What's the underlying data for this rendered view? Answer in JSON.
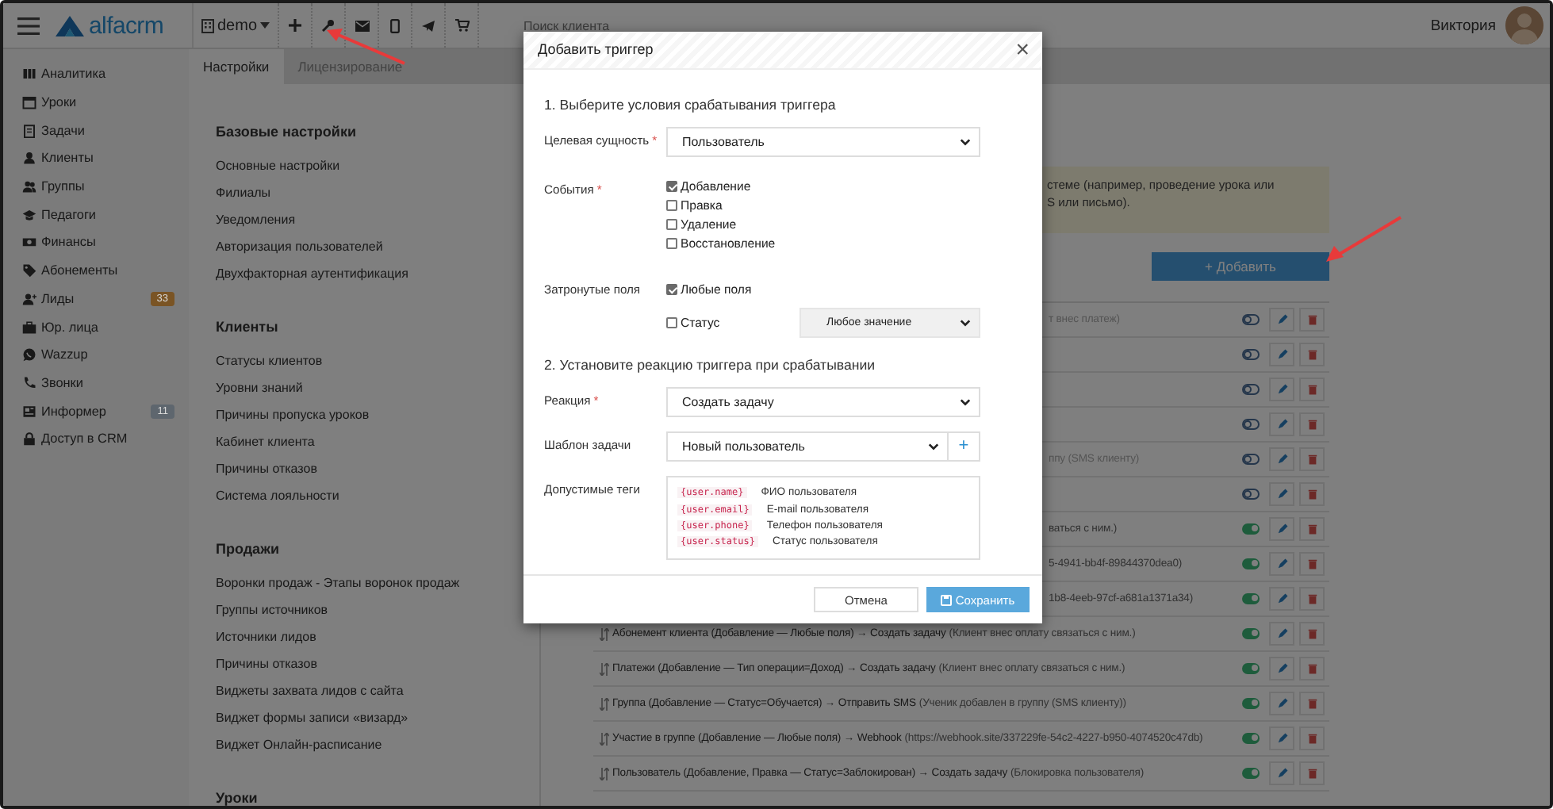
{
  "topbar": {
    "logo": "alfacrm",
    "branch": "demo",
    "search": {
      "placeholder": "Поиск клиента"
    },
    "user": "Виктория"
  },
  "sidebar": {
    "items": [
      {
        "label": "Аналитика"
      },
      {
        "label": "Уроки"
      },
      {
        "label": "Задачи"
      },
      {
        "label": "Клиенты"
      },
      {
        "label": "Группы"
      },
      {
        "label": "Педагоги"
      },
      {
        "label": "Финансы"
      },
      {
        "label": "Абонементы"
      },
      {
        "label": "Лиды",
        "badge": {
          "text": "33",
          "color": "#7a5424"
        }
      },
      {
        "label": "Юр. лица"
      },
      {
        "label": "Wazzup"
      },
      {
        "label": "Звонки"
      },
      {
        "label": "Информер",
        "badge": {
          "text": "11",
          "color": "#5e666e"
        }
      },
      {
        "label": "Доступ в CRM"
      }
    ]
  },
  "tabs": [
    {
      "label": "Настройки",
      "selected": true
    },
    {
      "label": "Лицензирование",
      "selected": false
    }
  ],
  "settings": [
    {
      "title": "Базовые настройки",
      "items": [
        "Основные настройки",
        "Филиалы",
        "Уведомления",
        "Авторизация пользователей",
        "Двухфакторная аутентификация"
      ]
    },
    {
      "title": "Клиенты",
      "items": [
        "Статусы клиентов",
        "Уровни знаний",
        "Причины пропуска уроков",
        "Кабинет клиента",
        "Причины отказов",
        "Система лояльности"
      ]
    },
    {
      "title": "Продажи",
      "items": [
        "Воронки продаж - Этапы воронок продаж",
        "Группы источников",
        "Источники лидов",
        "Причины отказов",
        "Виджеты захвата лидов с сайта",
        "Виджет формы записи «визард»",
        "Виджет Онлайн-расписание"
      ]
    },
    {
      "title": "Уроки"
    }
  ],
  "info": {
    "lines": [
      "стеме (например, проведение урока или",
      "S или письмо)."
    ]
  },
  "add_button": "+ Добавить",
  "triggers": [
    {
      "kind": "covered",
      "text": "т внес платеж)",
      "on": false
    },
    {
      "kind": "covered",
      "on": false
    },
    {
      "kind": "covered",
      "on": false
    },
    {
      "kind": "covered",
      "on": false
    },
    {
      "kind": "covered",
      "text": "ппу (SMS клиенту)",
      "on": false
    },
    {
      "kind": "covered",
      "on": false
    },
    {
      "kind": "covered",
      "text": "ваться с ним.)",
      "on": true
    },
    {
      "kind": "covered",
      "text": "5-4941-bb4f-89844370dea0)",
      "on": true
    },
    {
      "kind": "covered",
      "text": "1b8-4eeb-97cf-a681a1371a34)",
      "on": true
    },
    {
      "kind": "full",
      "rule": "Абонемент клиента (Добавление — Любые поля) → Создать задачу",
      "note": "(Клиент внес оплату связаться с ним.)",
      "on": true
    },
    {
      "kind": "full",
      "rule": "Платежи (Добавление — Тип операции=Доход) → Создать задачу",
      "note": "(Клиент внес оплату связаться с ним.)",
      "on": true
    },
    {
      "kind": "full",
      "rule": "Группа (Добавление — Статус=Обучается) → Отправить SMS",
      "note": "(Ученик добавлен в группу (SMS клиенту))",
      "on": true
    },
    {
      "kind": "full",
      "rule": "Участие в группе (Добавление — Любые поля) → Webhook",
      "note": "(https://webhook.site/337229fe-54c2-4227-b950-4074520c47db)",
      "on": true
    },
    {
      "kind": "full",
      "rule": "Пользователь (Добавление, Правка — Статус=Заблокирован) → Создать задачу",
      "note": "(Блокировка пользователя)",
      "on": true
    }
  ],
  "modal": {
    "title": "Добавить триггер",
    "close": "×",
    "section1": "1. Выберите условия срабатывания триггера",
    "target": {
      "label": "Целевая сущность",
      "mark": "*",
      "value": "Пользователь"
    },
    "events": {
      "label": "События",
      "mark": "*",
      "options": [
        {
          "label": "Добавление",
          "checked": true
        },
        {
          "label": "Правка",
          "checked": false
        },
        {
          "label": "Удаление",
          "checked": false
        },
        {
          "label": "Восстановление",
          "checked": false
        }
      ]
    },
    "fields": {
      "label": "Затронутые поля",
      "any": {
        "label": "Любые поля",
        "checked": true
      },
      "status": {
        "label": "Статус",
        "checked": false,
        "value": "Любое значение"
      }
    },
    "section2": "2. Установите реакцию триггера при срабатывании",
    "reaction": {
      "label": "Реакция",
      "mark": "*",
      "value": "Создать задачу"
    },
    "template": {
      "label": "Шаблон задачи",
      "value": "Новый пользователь",
      "add": "+"
    },
    "tags": {
      "label": "Допустимые теги",
      "items": [
        {
          "code": "{user.name}",
          "desc": "ФИО пользователя"
        },
        {
          "code": "{user.email}",
          "desc": "E-mail пользователя"
        },
        {
          "code": "{user.phone}",
          "desc": "Телефон пользователя"
        },
        {
          "code": "{user.status}",
          "desc": "Статус пользователя"
        }
      ]
    },
    "cancel": "Отмена",
    "save": "Сохранить"
  }
}
